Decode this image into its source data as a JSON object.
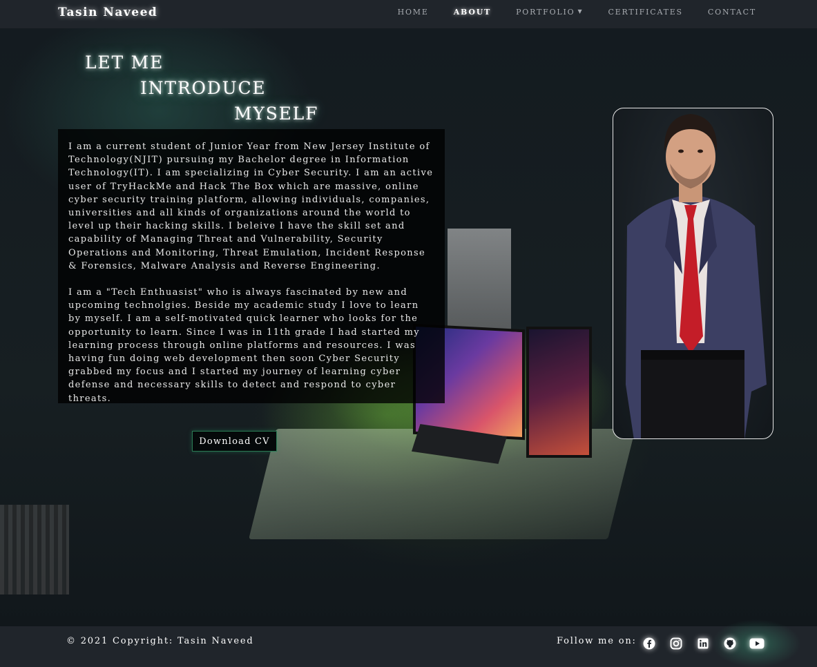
{
  "brand": "Tasin Naveed",
  "nav": {
    "home": "HOME",
    "about": "ABOUT",
    "portfolio": "PORTFOLIO",
    "certificates": "CERTIFICATES",
    "contact": "CONTACT",
    "active": "about"
  },
  "heading": {
    "line1": "LET ME",
    "line2": "INTRODUCE",
    "line3": "MYSELF"
  },
  "about": {
    "paragraph1": "I am a current student of Junior Year from New Jersey Institute of Technology(NJIT) pursuing my Bachelor degree in Information Technology(IT). I am specializing in Cyber Security. I am an active user of TryHackMe and Hack The Box which are massive, online cyber security training platform, allowing individuals, companies, universities and all kinds of organizations around the world to level up their hacking skills. I beleive I have the skill set and capability of Managing Threat and Vulnerability, Security Operations and Monitoring, Threat Emulation, Incident Response & Forensics, Malware Analysis and Reverse Engineering.",
    "paragraph2": "I am a \"Tech Enthuasist\" who is always fascinated by new and upcoming technolgies. Beside my academic study I love to learn by myself. I am a self-motivated quick learner who looks for the opportunity to learn. Since I was in 11th grade I had started my learning process through online platforms and resources. I was having fun doing web development then soon Cyber Security grabbed my focus and I started my journey of learning cyber defense and necessary skills to detect and respond to cyber threats."
  },
  "cv_button": "Download CV",
  "footer": {
    "copyright": "© 2021 Copyright: Tasin Naveed",
    "follow": "Follow me on:",
    "socials": [
      "facebook-icon",
      "instagram-icon",
      "linkedin-icon",
      "github-icon",
      "youtube-icon"
    ]
  },
  "colors": {
    "navbar": "#20252b",
    "accent_border": "#2a7a54",
    "glow": "#78ffd2"
  }
}
